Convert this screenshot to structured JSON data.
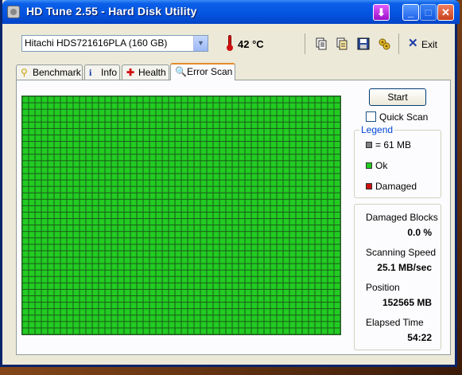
{
  "window": {
    "title": "HD Tune 2.55 - Hard Disk Utility",
    "title_buttons": [
      "download",
      "minimize",
      "maximize",
      "close"
    ]
  },
  "toolbar": {
    "drive": "Hitachi HDS721616PLA (160 GB)",
    "temperature": "42 °C",
    "icons": [
      "copy-text-icon",
      "copy-info-icon",
      "save-icon",
      "options-icon"
    ],
    "exit_label": "Exit"
  },
  "tabs": [
    {
      "label": "Benchmark",
      "icon": "benchmark-icon"
    },
    {
      "label": "Info",
      "icon": "info-icon"
    },
    {
      "label": "Health",
      "icon": "health-icon"
    },
    {
      "label": "Error Scan",
      "icon": "magnifier-icon",
      "active": true
    }
  ],
  "scan": {
    "start_label": "Start",
    "quick_scan_label": "Quick Scan",
    "quick_scan_checked": false,
    "grid": {
      "columns": 50,
      "rows": 37,
      "status": "ok"
    }
  },
  "legend": {
    "title": "Legend",
    "items": [
      {
        "label": "= 61 MB",
        "color": "#808080"
      },
      {
        "label": "Ok",
        "color": "#22cc22"
      },
      {
        "label": "Damaged",
        "color": "#d01010"
      }
    ]
  },
  "stats": {
    "damaged_blocks_label": "Damaged Blocks",
    "damaged_blocks_value": "0.0 %",
    "scanning_speed_label": "Scanning Speed",
    "scanning_speed_value": "25.1 MB/sec",
    "position_label": "Position",
    "position_value": "152565 MB",
    "elapsed_label": "Elapsed Time",
    "elapsed_value": "54:22"
  },
  "colors": {
    "ok_block": "#22cc22",
    "grid_line": "#1a5a1a",
    "titlebar": "#0453de"
  }
}
